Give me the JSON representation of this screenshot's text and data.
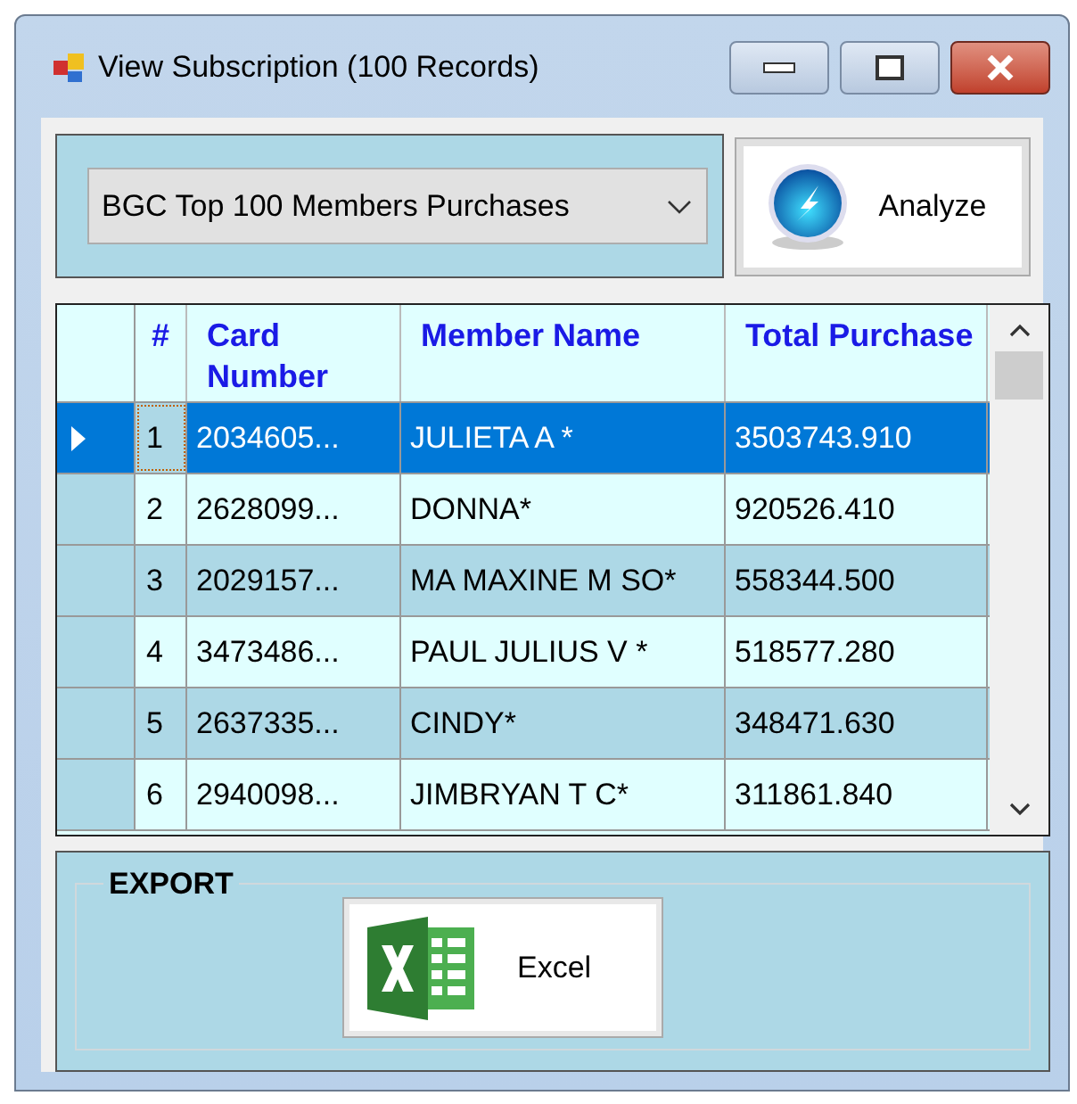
{
  "window": {
    "title": "View Subscription (100 Records)"
  },
  "report_dropdown": {
    "value": "BGC Top 100 Members Purchases"
  },
  "analyze_button": {
    "label": "Analyze"
  },
  "table": {
    "columns": [
      "#",
      "Card Number",
      "Member Name",
      "Total Purchase"
    ],
    "rows": [
      {
        "cells": [
          "1",
          "2034605...",
          "JULIETA A *",
          "3503743.910"
        ],
        "selected": true
      },
      {
        "cells": [
          "2",
          "2628099...",
          "DONNA*",
          "920526.410"
        ],
        "selected": false
      },
      {
        "cells": [
          "3",
          "2029157...",
          "MA MAXINE M SO*",
          "558344.500"
        ],
        "selected": false
      },
      {
        "cells": [
          "4",
          "3473486...",
          "PAUL JULIUS V *",
          "518577.280"
        ],
        "selected": false
      },
      {
        "cells": [
          "5",
          "2637335...",
          "CINDY*",
          "348471.630"
        ],
        "selected": false
      },
      {
        "cells": [
          "6",
          "2940098...",
          "JIMBRYAN T C*",
          "311861.840"
        ],
        "selected": false
      }
    ]
  },
  "export": {
    "title": "EXPORT",
    "button": "Excel"
  }
}
